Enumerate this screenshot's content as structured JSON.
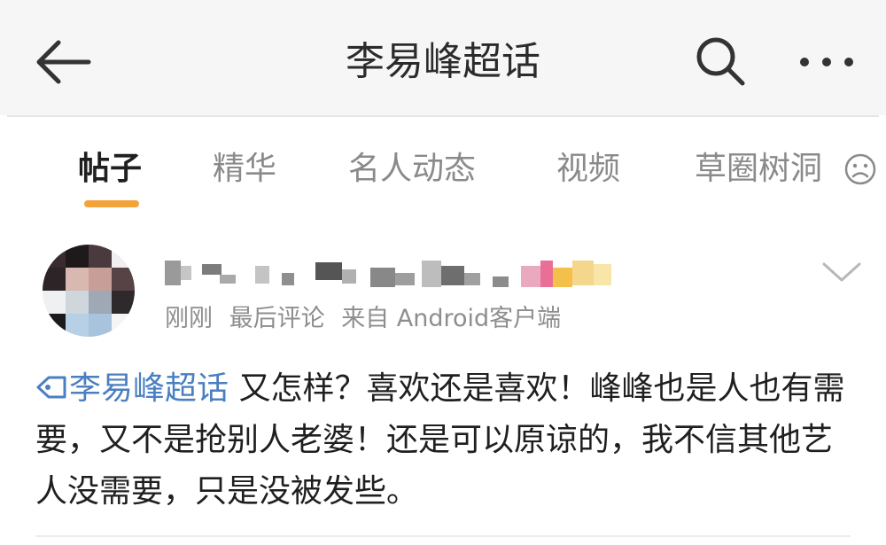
{
  "header": {
    "title": "李易峰超话"
  },
  "tabs": [
    {
      "label": "帖子"
    },
    {
      "label": "精华"
    },
    {
      "label": "名人动态"
    },
    {
      "label": "视频"
    },
    {
      "label": "草圈树洞"
    }
  ],
  "post": {
    "meta": {
      "time": "刚刚",
      "last_comment": "最后评论",
      "source": "来自 Android客户端"
    },
    "topic": "李易峰超话",
    "text": " 又怎样？喜欢还是喜欢！峰峰也是人也有需要，又不是抢别人老婆！还是可以原谅的，我不信其他艺人没需要，只是没被发些。"
  },
  "colors": {
    "accent_tab": "#f2a33a",
    "topic_link": "#4a7fc1",
    "topbar_bg": "#f6f6f6"
  },
  "icons": [
    "back-arrow-icon",
    "search-icon",
    "more-icon",
    "sad-face-icon",
    "chevron-down-icon",
    "topic-icon"
  ]
}
